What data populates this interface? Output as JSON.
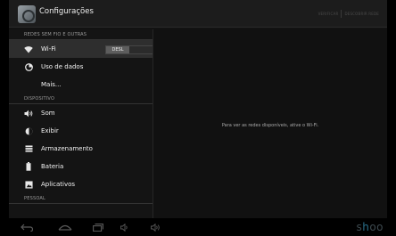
{
  "actionbar": {
    "title": "Configurações",
    "actions": [
      "VERIFICAR",
      "DESCOBRIR REDE"
    ]
  },
  "sidebar": {
    "sections": [
      {
        "header": "REDES SEM FIO E OUTRAS",
        "items": [
          {
            "label": "Wi-Fi",
            "icon": "wifi-icon",
            "toggle": "DESL"
          },
          {
            "label": "Uso de dados",
            "icon": "data-usage-icon"
          },
          {
            "label": "Mais...",
            "icon": ""
          }
        ]
      },
      {
        "header": "DISPOSITIVO",
        "items": [
          {
            "label": "Som",
            "icon": "sound-icon"
          },
          {
            "label": "Exibir",
            "icon": "display-icon"
          },
          {
            "label": "Armazenamento",
            "icon": "storage-icon"
          },
          {
            "label": "Bateria",
            "icon": "battery-icon"
          },
          {
            "label": "Aplicativos",
            "icon": "apps-icon"
          }
        ]
      },
      {
        "header": "PESSOAL",
        "items": []
      }
    ]
  },
  "main": {
    "message": "Para ver as redes disponíveis, ative o Wi-Fi."
  },
  "navbar": {
    "buttons": [
      "back-icon",
      "home-icon",
      "recents-icon",
      "volume-down-icon",
      "volume-up-icon"
    ],
    "logo": {
      "prefix": "s",
      "accent": "h",
      "suffix": "oo"
    }
  }
}
